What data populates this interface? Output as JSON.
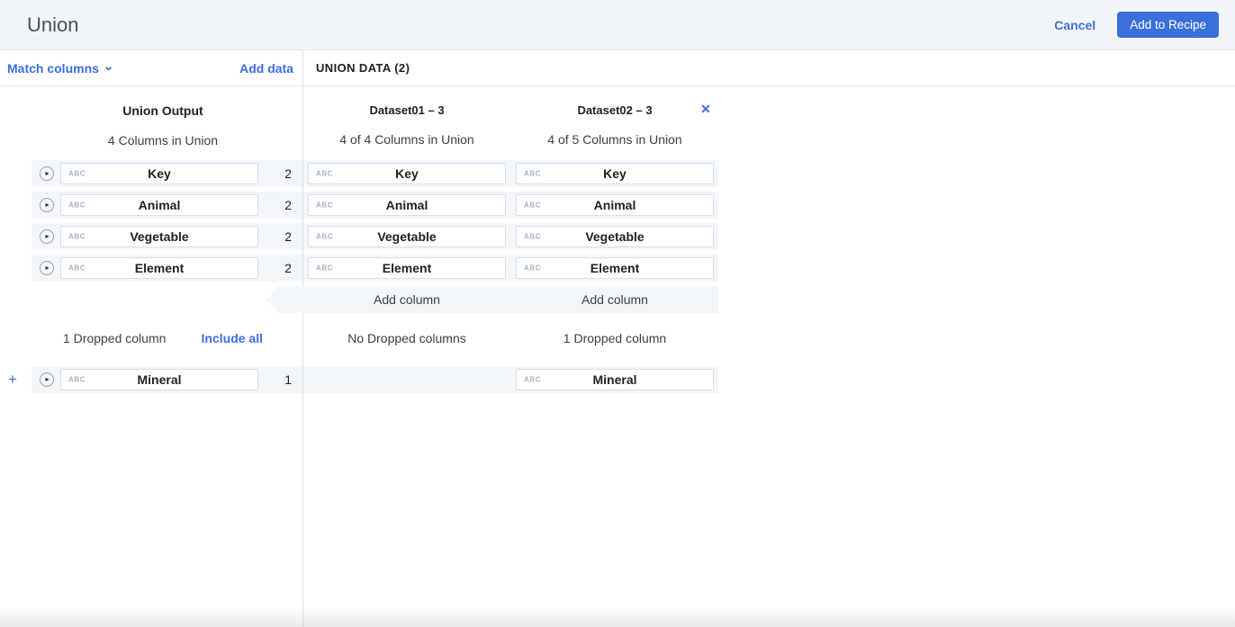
{
  "colors": {
    "accent": "#3b6fd9",
    "band": "#f3f6fa",
    "topbar_bg": "#f3f6f9",
    "border": "#e2e8ee",
    "field_border": "#d6dee7"
  },
  "icons": {
    "chevron_down": "⌄",
    "close": "✕",
    "plus": "+",
    "expand_play": "▸"
  },
  "topbar": {
    "title": "Union",
    "cancel_label": "Cancel",
    "add_to_recipe_label": "Add to Recipe"
  },
  "toolbar": {
    "match_columns_label": "Match columns",
    "add_data_label": "Add data",
    "union_data_label": "UNION DATA (2)"
  },
  "output_panel": {
    "title": "Union Output",
    "subtitle": "4 Columns in Union",
    "columns": [
      {
        "type": "ABC",
        "name": "Key",
        "count": "2"
      },
      {
        "type": "ABC",
        "name": "Animal",
        "count": "2"
      },
      {
        "type": "ABC",
        "name": "Vegetable",
        "count": "2"
      },
      {
        "type": "ABC",
        "name": "Element",
        "count": "2"
      }
    ],
    "dropped_summary": "1 Dropped column",
    "include_all_label": "Include all",
    "dropped_columns": [
      {
        "type": "ABC",
        "name": "Mineral",
        "count": "1"
      }
    ]
  },
  "union_data": {
    "add_column_label": "Add column",
    "datasets": [
      {
        "title": "Dataset01 – 3",
        "subtitle": "4 of 4 Columns in Union",
        "columns": [
          {
            "type": "ABC",
            "name": "Key"
          },
          {
            "type": "ABC",
            "name": "Animal"
          },
          {
            "type": "ABC",
            "name": "Vegetable"
          },
          {
            "type": "ABC",
            "name": "Element"
          }
        ],
        "dropped_summary": "No Dropped columns"
      },
      {
        "title": "Dataset02 – 3",
        "subtitle": "4 of 5 Columns in Union",
        "columns": [
          {
            "type": "ABC",
            "name": "Key"
          },
          {
            "type": "ABC",
            "name": "Animal"
          },
          {
            "type": "ABC",
            "name": "Vegetable"
          },
          {
            "type": "ABC",
            "name": "Element"
          }
        ],
        "dropped_summary": "1 Dropped column",
        "dropped_column": {
          "type": "ABC",
          "name": "Mineral"
        }
      }
    ]
  }
}
